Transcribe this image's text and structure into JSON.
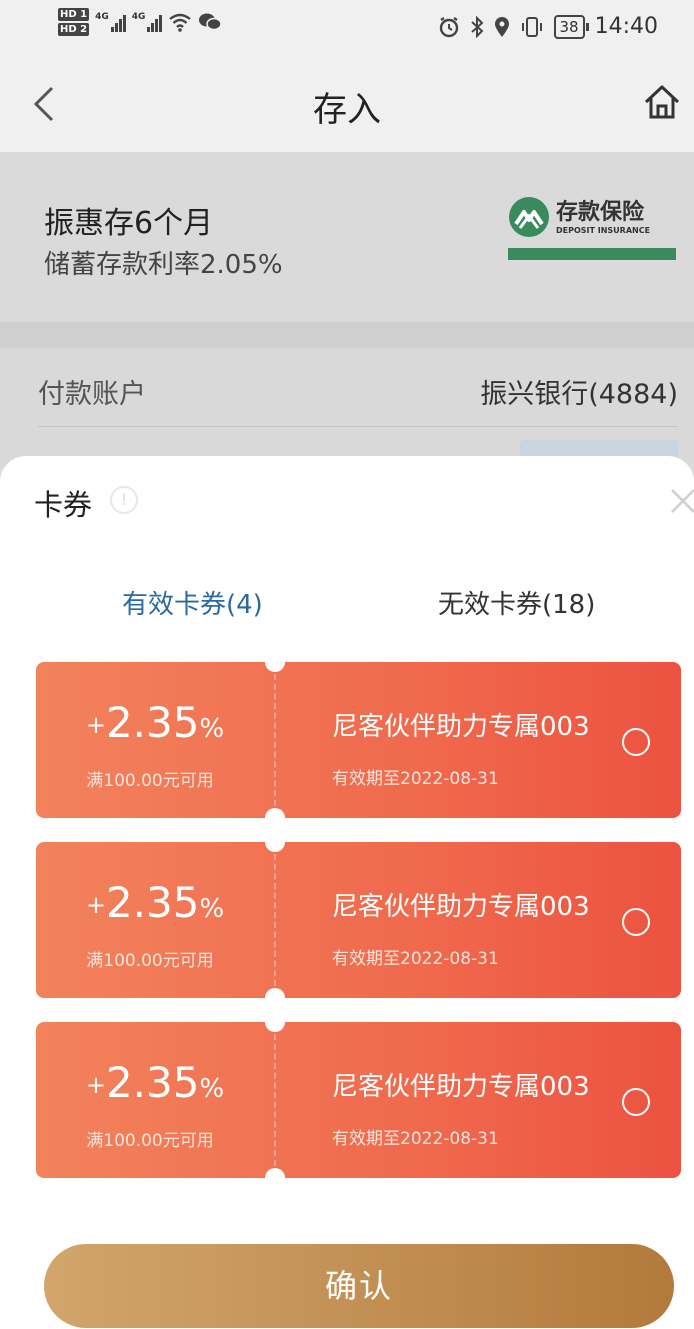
{
  "status_bar": {
    "hd1": "HD 1",
    "hd2": "HD 2",
    "net1": "4G",
    "net2": "4G",
    "battery": "38",
    "time": "14:40"
  },
  "nav": {
    "title": "存入",
    "back_icon": "chevron-left-icon",
    "home_icon": "home-icon"
  },
  "product": {
    "name": "振惠存6个月",
    "rate_text": "储蓄存款利率2.05%",
    "insurance": {
      "cn": "存款保险",
      "en": "DEPOSIT INSURANCE"
    }
  },
  "payment": {
    "label": "付款账户",
    "value": "振兴银行(4884)"
  },
  "sheet": {
    "title": "卡券",
    "tabs": [
      {
        "label": "有效卡券(4)",
        "active": true
      },
      {
        "label": "无效卡券(18)",
        "active": false
      }
    ],
    "coupons": [
      {
        "plus": "+",
        "rate": "2.35",
        "pct": "%",
        "condition": "满100.00元可用",
        "name": "尼客伙伴助力专属003",
        "expiry": "有效期至2022-08-31"
      },
      {
        "plus": "+",
        "rate": "2.35",
        "pct": "%",
        "condition": "满100.00元可用",
        "name": "尼客伙伴助力专属003",
        "expiry": "有效期至2022-08-31"
      },
      {
        "plus": "+",
        "rate": "2.35",
        "pct": "%",
        "condition": "满100.00元可用",
        "name": "尼客伙伴助力专属003",
        "expiry": "有效期至2022-08-31"
      }
    ],
    "confirm_label": "确认"
  },
  "colors": {
    "coupon_start": "#f2825c",
    "coupon_end": "#ec5240",
    "tab_active": "#2b6a9e",
    "confirm_gold": "#c18e52",
    "insurance_green": "#3a8a5e"
  }
}
